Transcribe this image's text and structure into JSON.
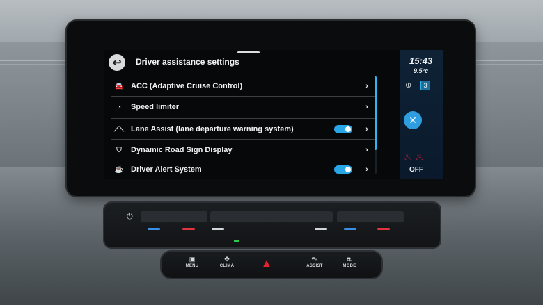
{
  "header": {
    "title": "Driver assistance settings"
  },
  "items": [
    {
      "label": "ACC (Adaptive Cruise Control)",
      "icon": "acc-icon",
      "toggle": null
    },
    {
      "label": "Speed limiter",
      "icon": "speed-limiter-icon",
      "toggle": null
    },
    {
      "label": "Lane Assist (lane departure warning system)",
      "icon": "lane-assist-icon",
      "toggle": true
    },
    {
      "label": "Dynamic Road Sign Display",
      "icon": "road-sign-icon",
      "toggle": null
    },
    {
      "label": "Driver Alert System",
      "icon": "driver-alert-icon",
      "toggle": true
    }
  ],
  "status": {
    "time": "15:43",
    "temperature": "9.5°c",
    "badge": "3",
    "seat_heat": "OFF"
  },
  "bottom_bar": {
    "menu": "MENU",
    "clima": "CLIMA",
    "assist": "ASSIST",
    "mode": "MODE"
  },
  "colors": {
    "accent": "#2aa6e6",
    "hazard": "#e2232f",
    "seat_heat": "#d9233a"
  }
}
